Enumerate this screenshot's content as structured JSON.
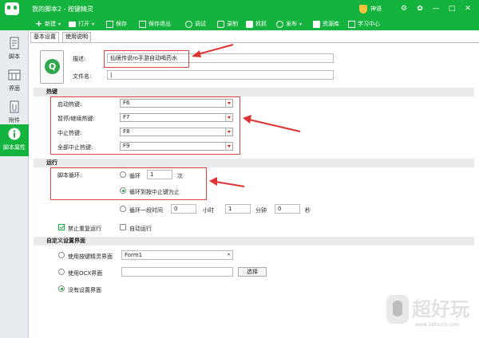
{
  "window": {
    "title": "我的脚本2 - 按键精灵",
    "user": "神语",
    "controls": [
      "settings",
      "skin",
      "minimize",
      "maximize",
      "close"
    ]
  },
  "toolbar": {
    "items": [
      {
        "label": "新建",
        "icon": "plus-icon",
        "dropdown": true
      },
      {
        "label": "打开",
        "icon": "folder-icon",
        "dropdown": true
      },
      {
        "label": "保存",
        "icon": "save-icon",
        "dropdown": false
      },
      {
        "label": "保存退出",
        "icon": "save-exit-icon",
        "dropdown": false
      },
      {
        "label": "调试",
        "icon": "debug-icon",
        "dropdown": false
      },
      {
        "label": "录制",
        "icon": "record-icon",
        "dropdown": false
      },
      {
        "label": "抓抓",
        "icon": "capture-icon",
        "dropdown": false
      },
      {
        "label": "发布",
        "icon": "publish-icon",
        "dropdown": true
      },
      {
        "label": "资源库",
        "icon": "library-icon",
        "dropdown": false
      },
      {
        "label": "学习中心",
        "icon": "learn-icon",
        "dropdown": false
      }
    ]
  },
  "sidebar": {
    "items": [
      {
        "label": "脚本",
        "icon": "script-icon",
        "active": false
      },
      {
        "label": "界面",
        "icon": "ui-grid-icon",
        "active": false
      },
      {
        "label": "附件",
        "icon": "attachment-icon",
        "active": false
      },
      {
        "label": "脚本属性",
        "icon": "info-icon",
        "active": true
      }
    ]
  },
  "tabs": [
    {
      "label": "基本设置",
      "active": true
    },
    {
      "label": "使用说明",
      "active": false
    }
  ],
  "basic": {
    "description_label": "描述:",
    "description_value": "仙境传说ro手游自动喝药水",
    "filename_label": "文件名:",
    "filename_value": "|"
  },
  "hotkeys": {
    "section_title": "热键",
    "rows": [
      {
        "label": "启动热键:",
        "value": "F6"
      },
      {
        "label": "暂停/继续热键:",
        "value": "F7"
      },
      {
        "label": "中止热键:",
        "value": "F8"
      },
      {
        "label": "全部中止热键:",
        "value": "F9"
      }
    ]
  },
  "run": {
    "section_title": "运行",
    "loop_label": "脚本循环:",
    "loop_option": "循环",
    "loop_count": "1",
    "loop_unit": "次",
    "until_stop_option": "循环到按中止键为止",
    "timed_option": "循环一段时间",
    "hours_value": "0",
    "hours_unit": "小时",
    "minutes_value": "1",
    "minutes_unit": "分钟",
    "seconds_value": "0",
    "seconds_unit": "秒",
    "selected": "until_stop",
    "no_repeat_label": "禁止重复运行",
    "no_repeat_checked": true,
    "auto_run_label": "自动运行",
    "auto_run_checked": false
  },
  "custom_ui": {
    "section_title": "自定义设置界面",
    "use_builtin_label": "使用按键精灵界面",
    "builtin_select_value": "Form1",
    "use_ocx_label": "使用OCX界面",
    "browse_button": "选择",
    "none_label": "没有设置界面",
    "selected": "none"
  },
  "watermark": {
    "text": "超好玩",
    "url": "www.18touch.com"
  },
  "colors": {
    "brand_green": "#14b33d",
    "annotation_red": "#dd3333"
  }
}
